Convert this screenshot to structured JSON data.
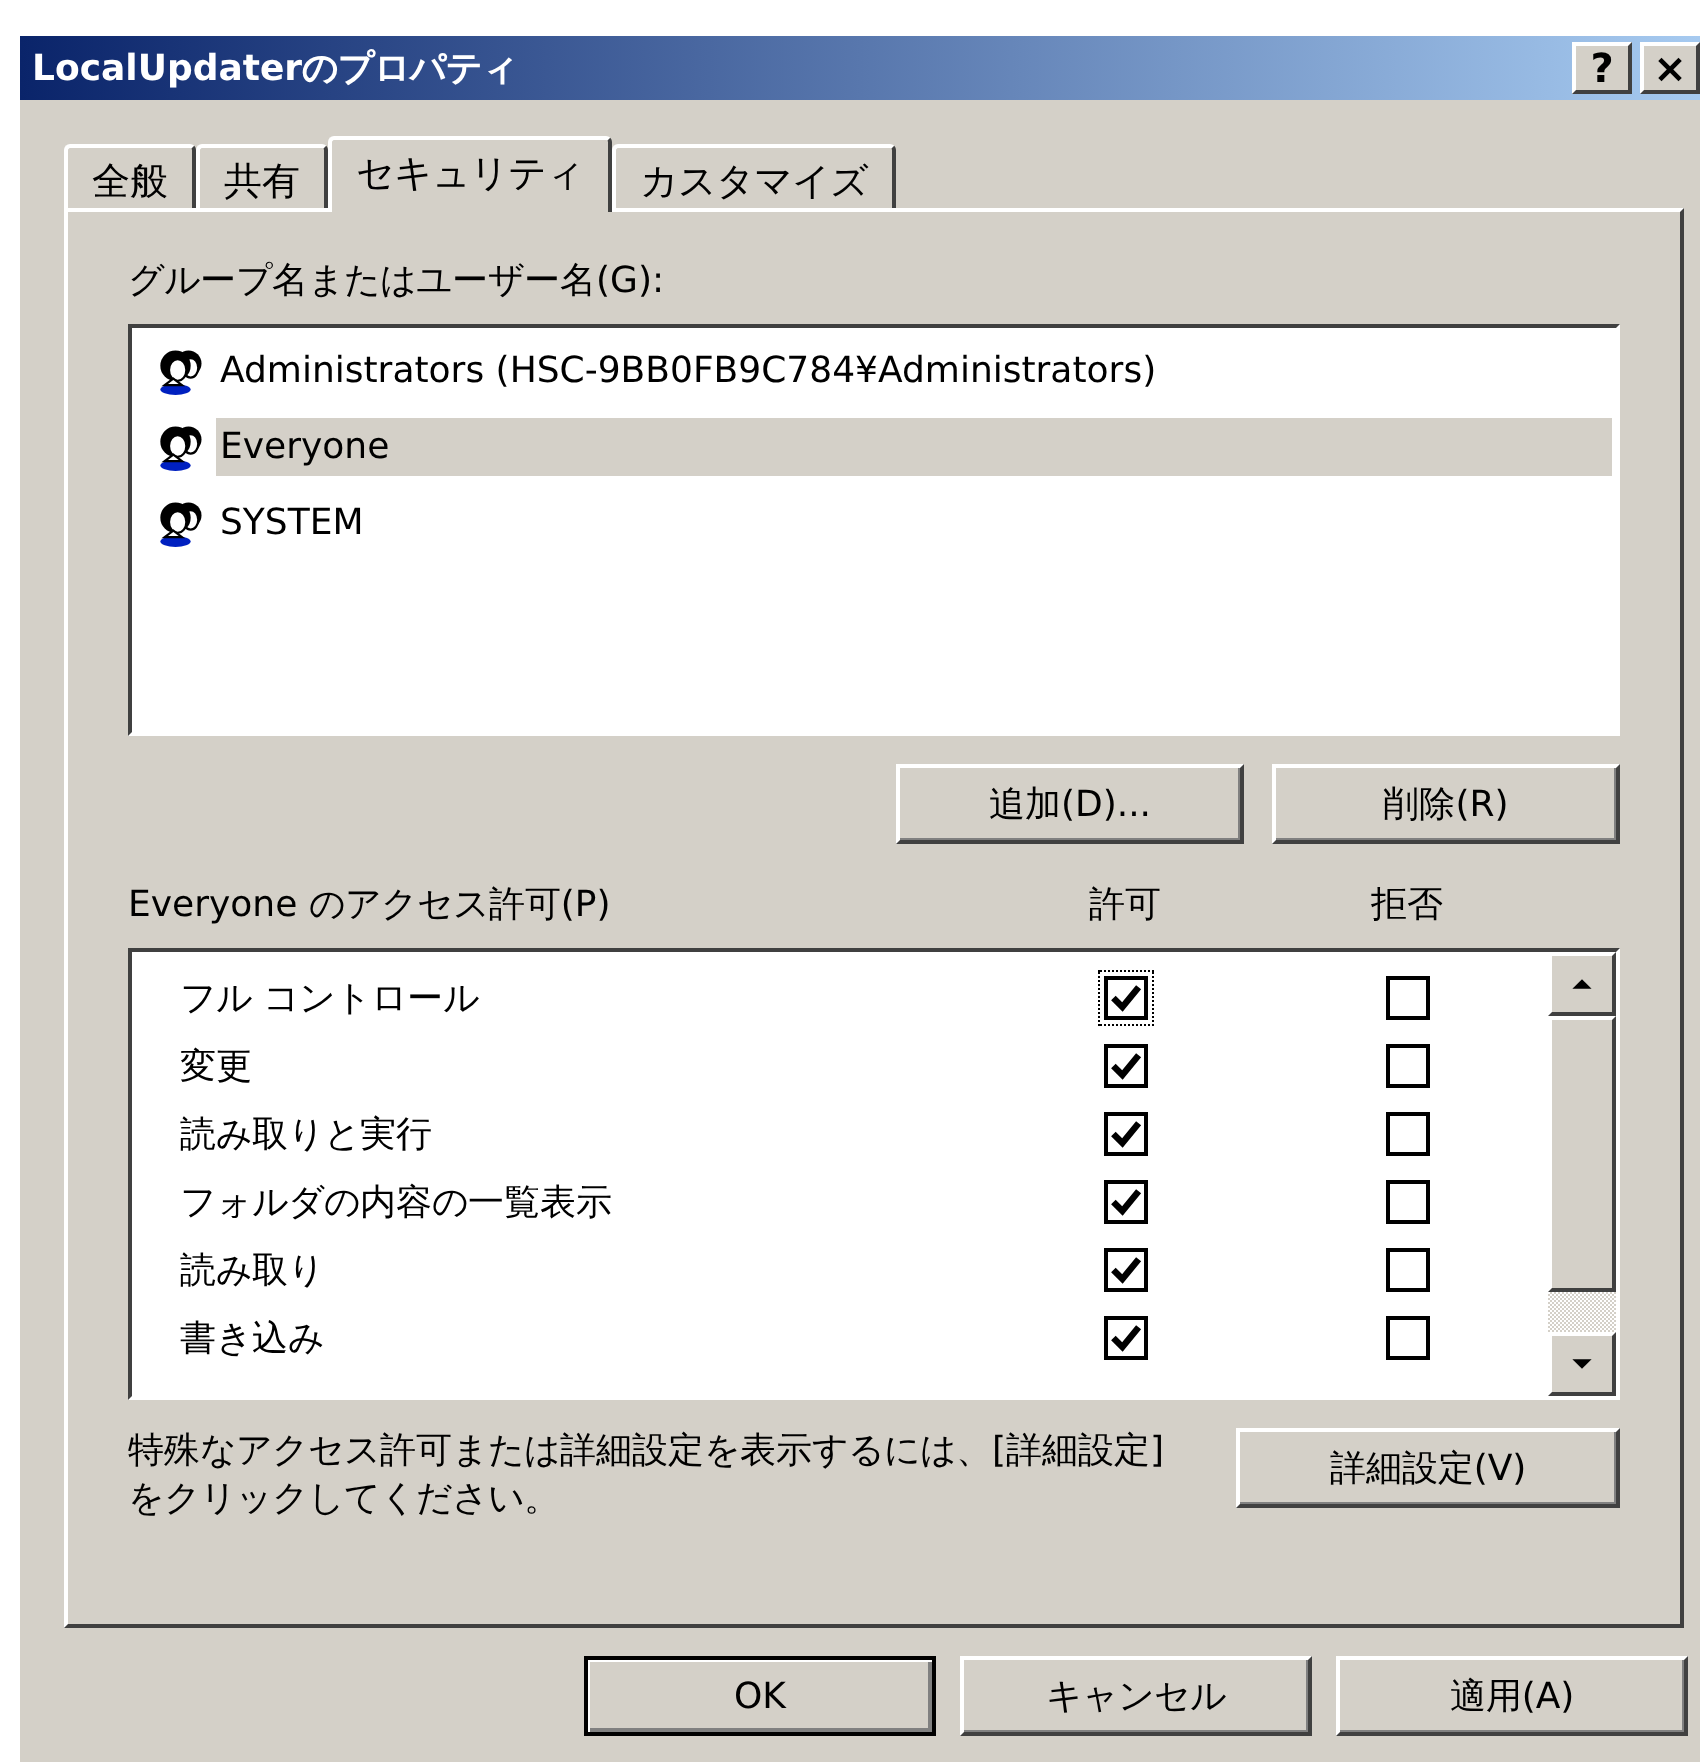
{
  "window": {
    "title": "LocalUpdaterのプロパティ",
    "controls": [
      {
        "kind": "help",
        "label": "?"
      },
      {
        "kind": "close",
        "label": "×"
      }
    ]
  },
  "tabs": [
    {
      "label": "全般",
      "selected": false
    },
    {
      "label": "共有",
      "selected": false
    },
    {
      "label": "セキュリティ",
      "selected": true
    },
    {
      "label": "カスタマイズ",
      "selected": false
    }
  ],
  "group_label": "グループ名またはユーザー名(G):",
  "principals": [
    {
      "name": "Administrators (HSC-9BB0FB9C784¥Administrators)",
      "selected": false
    },
    {
      "name": "Everyone",
      "selected": true
    },
    {
      "name": "SYSTEM",
      "selected": false
    }
  ],
  "principal_buttons": [
    "追加(D)...",
    "削除(R)"
  ],
  "permissions": {
    "label": "Everyone のアクセス許可(P)",
    "columns": [
      "許可",
      "拒否"
    ],
    "rows": [
      {
        "name": "フル コントロール",
        "allow": true,
        "deny": false,
        "focused": true
      },
      {
        "name": "変更",
        "allow": true,
        "deny": false,
        "focused": false
      },
      {
        "name": "読み取りと実行",
        "allow": true,
        "deny": false,
        "focused": false
      },
      {
        "name": "フォルダの内容の一覧表示",
        "allow": true,
        "deny": false,
        "focused": false
      },
      {
        "name": "読み取り",
        "allow": true,
        "deny": false,
        "focused": false
      },
      {
        "name": "書き込み",
        "allow": true,
        "deny": false,
        "focused": false
      }
    ]
  },
  "advanced_note": "特殊なアクセス許可または詳細設定を表示するには、[詳細設定] をクリックしてください。",
  "advanced_button": "詳細設定(V)",
  "dialog_buttons": [
    {
      "label": "OK",
      "default": true
    },
    {
      "label": "キャンセル",
      "default": false
    },
    {
      "label": "適用(A)",
      "default": false
    }
  ]
}
